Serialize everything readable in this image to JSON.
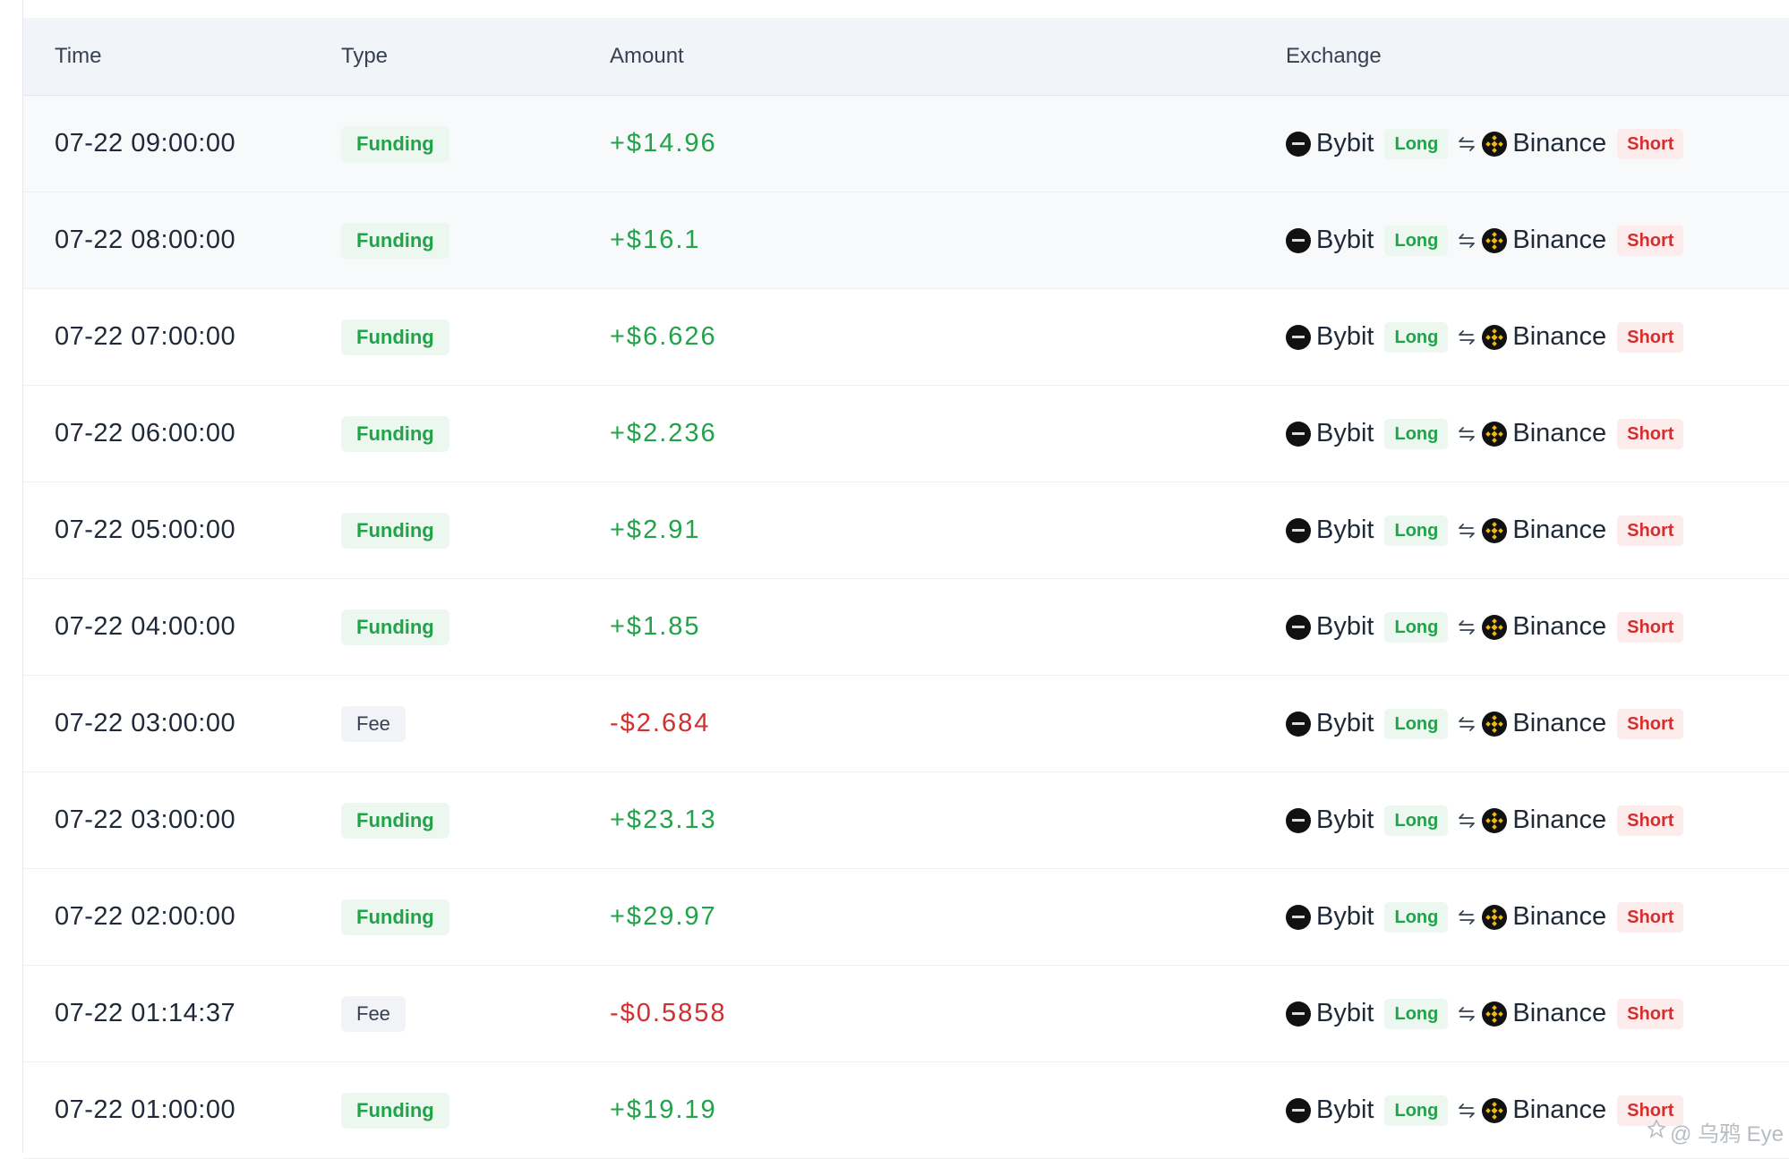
{
  "table": {
    "headers": {
      "time": "Time",
      "type": "Type",
      "amount": "Amount",
      "exchange": "Exchange"
    },
    "rows": [
      {
        "time": "07-22 09:00:00",
        "type": "Funding",
        "amount": "+$14.96",
        "sign": "pos",
        "long_exchange": "Bybit",
        "long_label": "Long",
        "short_exchange": "Binance",
        "short_label": "Short"
      },
      {
        "time": "07-22 08:00:00",
        "type": "Funding",
        "amount": "+$16.1",
        "sign": "pos",
        "long_exchange": "Bybit",
        "long_label": "Long",
        "short_exchange": "Binance",
        "short_label": "Short"
      },
      {
        "time": "07-22 07:00:00",
        "type": "Funding",
        "amount": "+$6.626",
        "sign": "pos",
        "long_exchange": "Bybit",
        "long_label": "Long",
        "short_exchange": "Binance",
        "short_label": "Short"
      },
      {
        "time": "07-22 06:00:00",
        "type": "Funding",
        "amount": "+$2.236",
        "sign": "pos",
        "long_exchange": "Bybit",
        "long_label": "Long",
        "short_exchange": "Binance",
        "short_label": "Short"
      },
      {
        "time": "07-22 05:00:00",
        "type": "Funding",
        "amount": "+$2.91",
        "sign": "pos",
        "long_exchange": "Bybit",
        "long_label": "Long",
        "short_exchange": "Binance",
        "short_label": "Short"
      },
      {
        "time": "07-22 04:00:00",
        "type": "Funding",
        "amount": "+$1.85",
        "sign": "pos",
        "long_exchange": "Bybit",
        "long_label": "Long",
        "short_exchange": "Binance",
        "short_label": "Short"
      },
      {
        "time": "07-22 03:00:00",
        "type": "Fee",
        "amount": "-$2.684",
        "sign": "neg",
        "long_exchange": "Bybit",
        "long_label": "Long",
        "short_exchange": "Binance",
        "short_label": "Short"
      },
      {
        "time": "07-22 03:00:00",
        "type": "Funding",
        "amount": "+$23.13",
        "sign": "pos",
        "long_exchange": "Bybit",
        "long_label": "Long",
        "short_exchange": "Binance",
        "short_label": "Short"
      },
      {
        "time": "07-22 02:00:00",
        "type": "Funding",
        "amount": "+$29.97",
        "sign": "pos",
        "long_exchange": "Bybit",
        "long_label": "Long",
        "short_exchange": "Binance",
        "short_label": "Short"
      },
      {
        "time": "07-22 01:14:37",
        "type": "Fee",
        "amount": "-$0.5858",
        "sign": "neg",
        "long_exchange": "Bybit",
        "long_label": "Long",
        "short_exchange": "Binance",
        "short_label": "Short"
      },
      {
        "time": "07-22 01:00:00",
        "type": "Funding",
        "amount": "+$19.19",
        "sign": "pos",
        "long_exchange": "Bybit",
        "long_label": "Long",
        "short_exchange": "Binance",
        "short_label": "Short"
      }
    ]
  },
  "icons": {
    "bybit_logo": "bybit-logo-icon",
    "binance_logo": "binance-logo-icon",
    "swap": "swap-arrows-icon"
  },
  "colors": {
    "positive": "#22a34a",
    "negative": "#d32f2f",
    "binance_yellow": "#f0b90b"
  },
  "watermark": {
    "text": "@ 乌鸦 Eye"
  }
}
